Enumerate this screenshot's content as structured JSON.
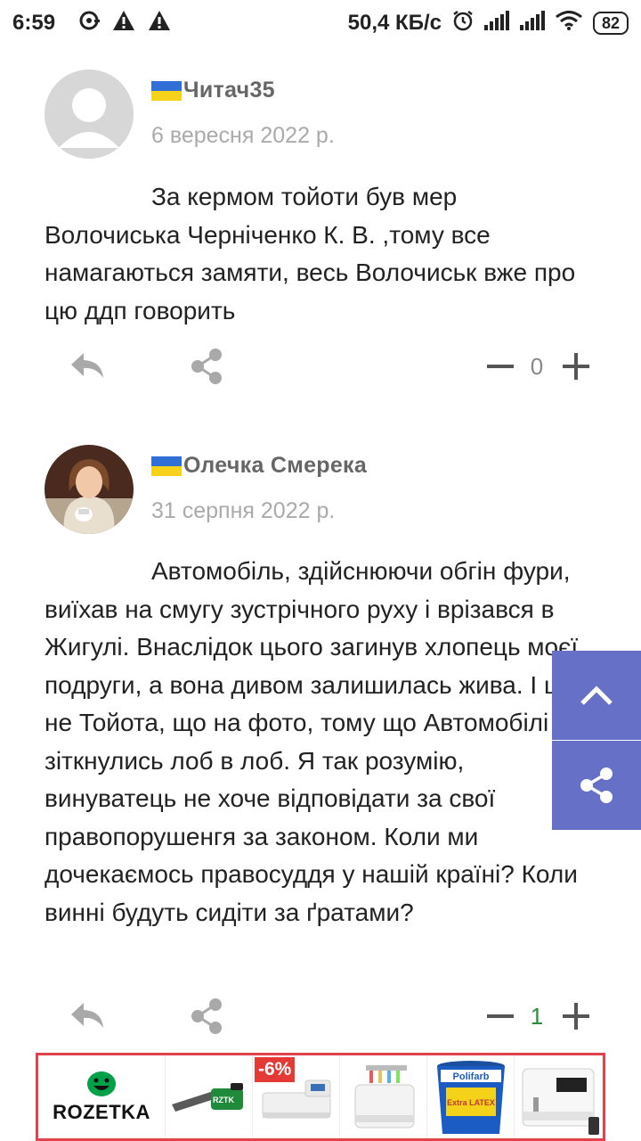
{
  "status_bar": {
    "time": "6:59",
    "network_speed": "50,4 КБ/с",
    "battery": "82"
  },
  "comments": [
    {
      "author": "Читач35",
      "date": "6 вересня 2022 р.",
      "text": "За кермом тойоти був мер Волочиська Черніченко К. В.  ,тому все намагаються замяти, весь Волочиськ вже про цю ддп говорить",
      "votes": "0"
    },
    {
      "author": "Олечка Смерека",
      "date": "31 серпня 2022 р.",
      "text": "Автомобіль, здійснюючи обгін фури, виїхав на смугу зустрічного руху і врізався в Жигулі. Внаслідок цього загинув хлопець моєї подруги, а вона дивом залишилась жива. І це не Тойота, що на фото, тому що Автомобілі зіткнулись лоб в лоб. Я так розумію, винуватець не хоче відповідати за свої правопорушенгя за законом. Коли ми дочекаємось правосуддя у нашій країні? Коли винні будуть сидіти за ґратами?",
      "votes": "1"
    }
  ],
  "ad": {
    "brand": "ROZETKA",
    "discount": "-6%",
    "product_label_1": "Polifarb",
    "product_label_2": "Extra LATEX",
    "chainsaw_label": "RZTK"
  },
  "colors": {
    "side_button": "#6670c7",
    "ad_border": "#e0424e",
    "positive_votes": "#2e8b3a"
  }
}
